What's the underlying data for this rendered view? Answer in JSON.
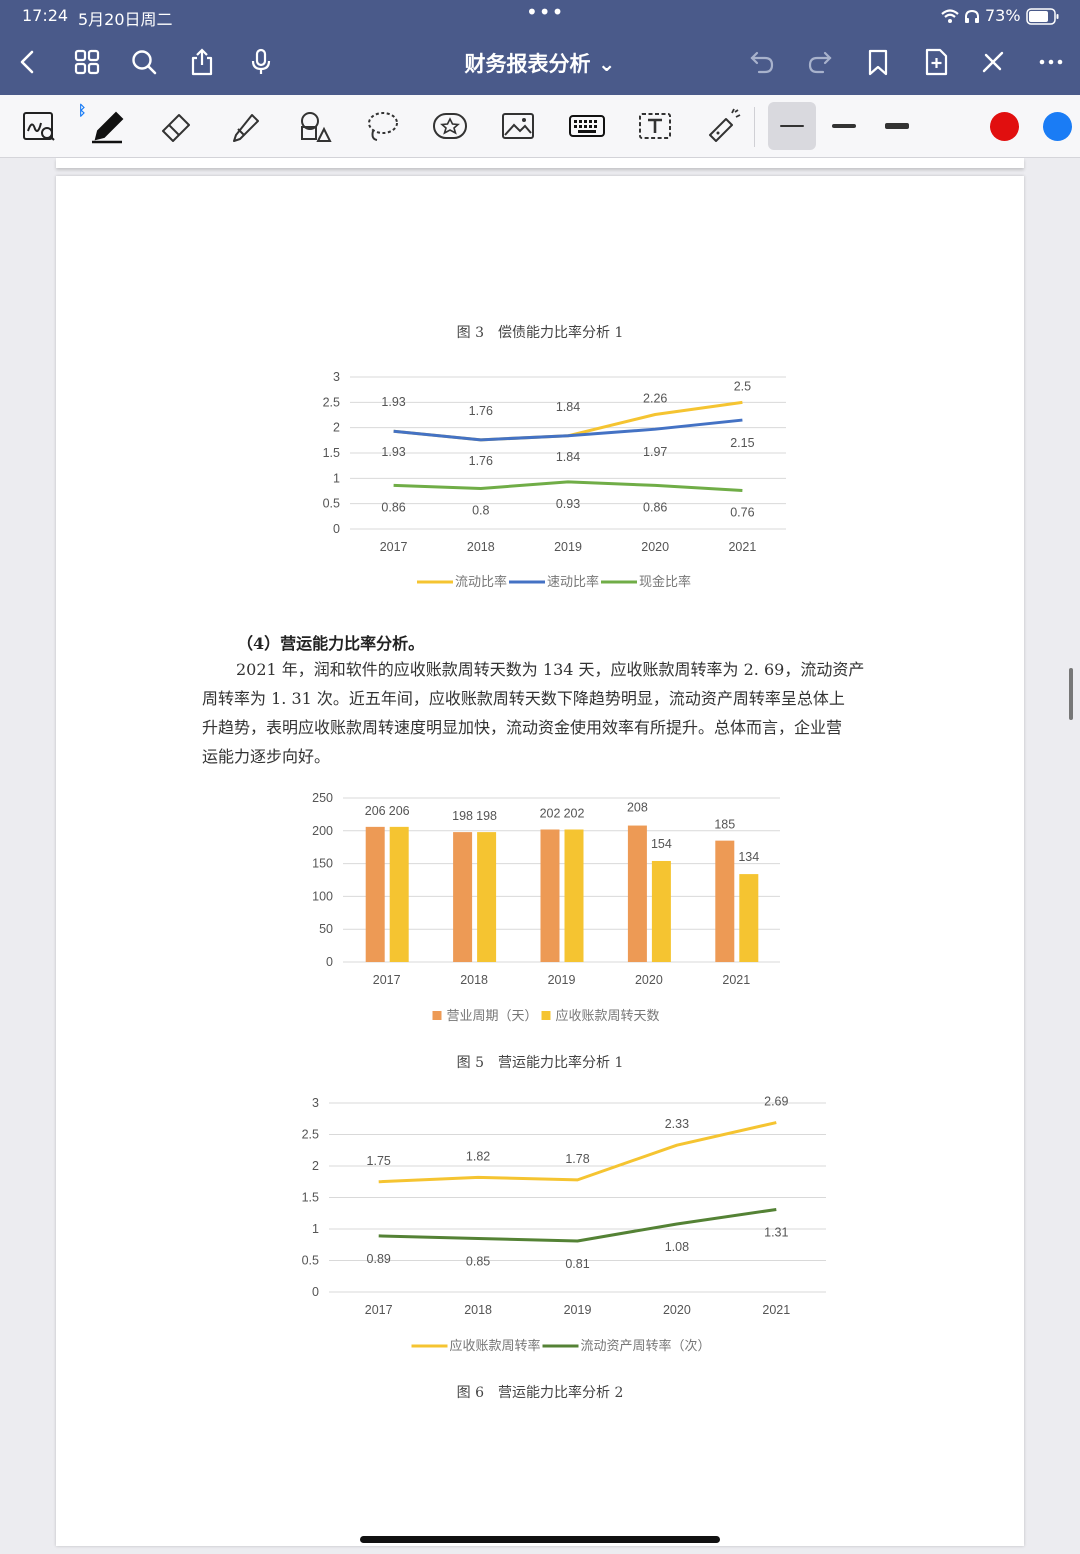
{
  "status_bar": {
    "time": "17:24",
    "date": "5月20日周二",
    "battery": "73%"
  },
  "header": {
    "title": "财务报表分析 ⌄"
  },
  "colors": {
    "header_bg": "#4a5a8a",
    "yellow": "#f5c431",
    "blue": "#4472c4",
    "green": "#70ad47",
    "orange": "#ed9a55",
    "dark_green": "#548235",
    "red_swatch": "#e10f0f",
    "blue_swatch": "#1a7cf5"
  },
  "captions": {
    "fig3": "图 3　偿债能力比率分析 1",
    "fig5": "图 5　营运能力比率分析 1",
    "fig6": "图 6　营运能力比率分析 2"
  },
  "section": {
    "heading": "（4）营运能力比率分析。",
    "lines": [
      "2021 年，润和软件的应收账款周转天数为 134 天，应收账款周转率为 2. 69，流动资产",
      "周转率为 1. 31 次。近五年间，应收账款周转天数下降趋势明显，流动资产周转率呈总体上",
      "升趋势，表明应收账款周转速度明显加快，流动资金使用效率有所提升。总体而言，企业营",
      "运能力逐步向好。"
    ]
  },
  "chart_data": [
    {
      "type": "line",
      "x": [
        "2017",
        "2018",
        "2019",
        "2020",
        "2021"
      ],
      "ylim": [
        0,
        3
      ],
      "yticks": [
        "0",
        "0.5",
        "1",
        "1.5",
        "2",
        "2.5",
        "3"
      ],
      "series": [
        {
          "name": "流动比率",
          "color": "#f5c431",
          "values": [
            1.93,
            1.76,
            1.84,
            2.26,
            2.5
          ]
        },
        {
          "name": "速动比率",
          "color": "#4472c4",
          "values": [
            1.93,
            1.76,
            1.84,
            1.97,
            2.15
          ]
        },
        {
          "name": "现金比率",
          "color": "#70ad47",
          "values": [
            0.86,
            0.8,
            0.93,
            0.86,
            0.76
          ]
        }
      ],
      "labels": {
        "流动比率": [
          "1.93",
          "1.76",
          "1.84",
          "2.26",
          "2.5"
        ],
        "速动比率": [
          "1.93",
          "1.76",
          "1.84",
          "1.97",
          "2.15"
        ],
        "现金比率": [
          "0.86",
          "0.8",
          "0.93",
          "0.86",
          "0.76"
        ]
      },
      "legend": "bottom"
    },
    {
      "type": "bar",
      "categories": [
        "2017",
        "2018",
        "2019",
        "2020",
        "2021"
      ],
      "ylim": [
        0,
        250
      ],
      "yticks": [
        "0",
        "50",
        "100",
        "150",
        "200",
        "250"
      ],
      "series": [
        {
          "name": "营业周期（天）",
          "color": "#ed9a55",
          "values": [
            206,
            198,
            202,
            208,
            185
          ]
        },
        {
          "name": "应收账款周转天数",
          "color": "#f5c431",
          "values": [
            206,
            198,
            202,
            154,
            134
          ]
        }
      ],
      "legend": "bottom"
    },
    {
      "type": "line",
      "x": [
        "2017",
        "2018",
        "2019",
        "2020",
        "2021"
      ],
      "ylim": [
        0,
        3
      ],
      "yticks": [
        "0",
        "0.5",
        "1",
        "1.5",
        "2",
        "2.5",
        "3"
      ],
      "series": [
        {
          "name": "应收账款周转率",
          "color": "#f5c431",
          "values": [
            1.75,
            1.82,
            1.78,
            2.33,
            2.69
          ]
        },
        {
          "name": "流动资产周转率（次）",
          "color": "#548235",
          "values": [
            0.89,
            0.85,
            0.81,
            1.08,
            1.31
          ]
        }
      ],
      "legend": "bottom"
    }
  ]
}
